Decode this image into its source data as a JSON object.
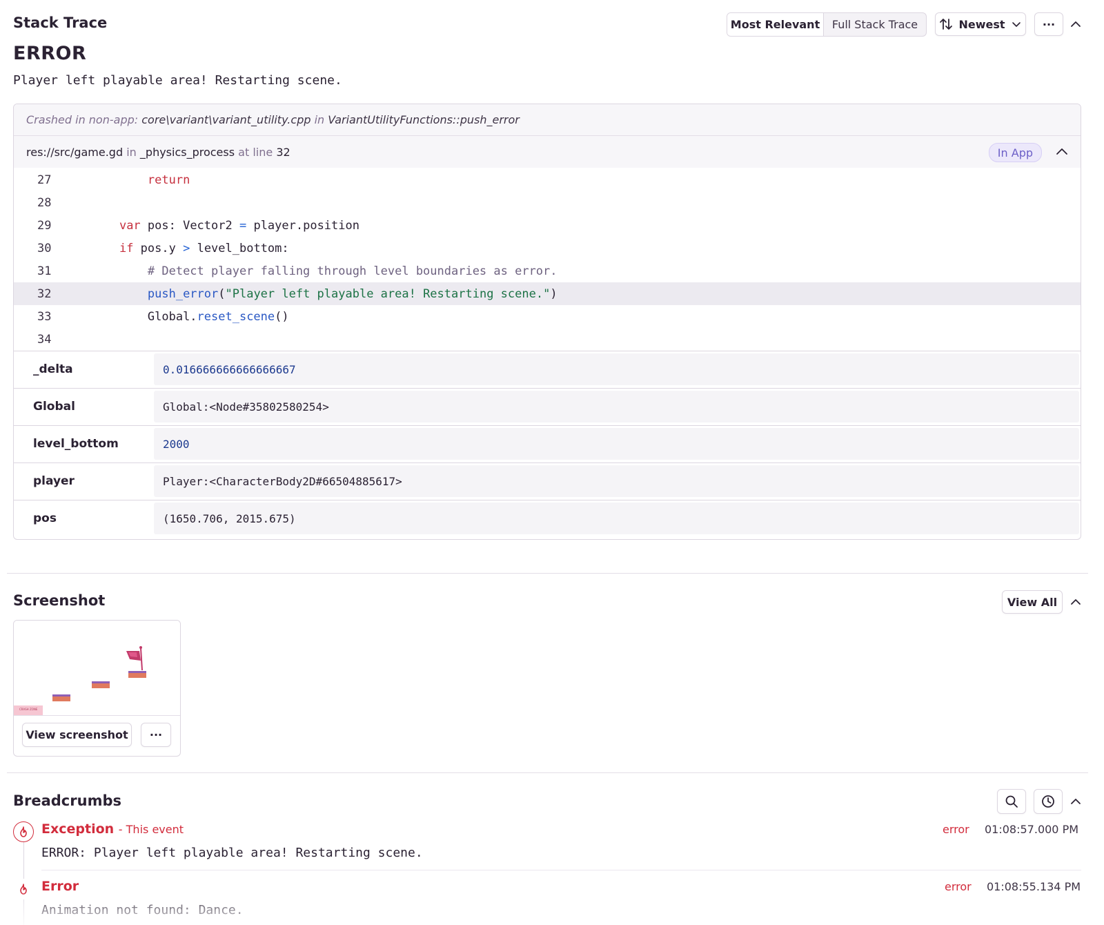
{
  "stack_trace": {
    "title": "Stack Trace",
    "view_options": [
      "Most Relevant",
      "Full Stack Trace"
    ],
    "sort_label": "Newest",
    "more_label": "···",
    "exception_type": "ERROR",
    "exception_message": "Player left playable area! Restarting scene.",
    "crash_prefix": "Crashed in non-app:",
    "crash_file": "core\\variant\\variant_utility.cpp",
    "crash_in": "in",
    "crash_function": "VariantUtilityFunctions::push_error",
    "frame": {
      "file": "res://src/game.gd",
      "in_word": "in",
      "function": "_physics_process",
      "at_line_word": "at line",
      "line": "32",
      "badge": "In App"
    },
    "code_lines": [
      {
        "n": "27",
        "indent": "        ",
        "parts": [
          [
            "kw",
            "return"
          ]
        ]
      },
      {
        "n": "28",
        "indent": "",
        "parts": []
      },
      {
        "n": "29",
        "indent": "    ",
        "parts": [
          [
            "kw",
            "var"
          ],
          [
            "t",
            " pos: Vector2 "
          ],
          [
            "op",
            "="
          ],
          [
            "t",
            " player.position"
          ]
        ]
      },
      {
        "n": "30",
        "indent": "    ",
        "parts": [
          [
            "kw",
            "if"
          ],
          [
            "t",
            " pos.y "
          ],
          [
            "op",
            ">"
          ],
          [
            "t",
            " level_bottom:"
          ]
        ]
      },
      {
        "n": "31",
        "indent": "        ",
        "parts": [
          [
            "cm",
            "# Detect player falling through level boundaries as error."
          ]
        ]
      },
      {
        "n": "32",
        "indent": "        ",
        "parts": [
          [
            "fn",
            "push_error"
          ],
          [
            "t",
            "("
          ],
          [
            "str",
            "\"Player left playable area! Restarting scene.\""
          ],
          [
            "t",
            ")"
          ]
        ],
        "highlight": true
      },
      {
        "n": "33",
        "indent": "        ",
        "parts": [
          [
            "t",
            "Global."
          ],
          [
            "fn",
            "reset_scene"
          ],
          [
            "t",
            "()"
          ]
        ]
      },
      {
        "n": "34",
        "indent": "",
        "parts": []
      }
    ],
    "variables": [
      {
        "key": "_delta",
        "value": "0.016666666666666667",
        "numeric": true
      },
      {
        "key": "Global",
        "value": "Global:<Node#35802580254>",
        "numeric": false
      },
      {
        "key": "level_bottom",
        "value": "2000",
        "numeric": true
      },
      {
        "key": "player",
        "value": "Player:<CharacterBody2D#66504885617>",
        "numeric": false
      },
      {
        "key": "pos",
        "value": "(1650.706, 2015.675)",
        "numeric": false
      }
    ]
  },
  "screenshot": {
    "title": "Screenshot",
    "view_all_label": "View All",
    "view_button_label": "View screenshot",
    "more_label": "···",
    "thumb_badge_text": "CRASH ZONE"
  },
  "breadcrumbs": {
    "title": "Breadcrumbs",
    "items": [
      {
        "type": "Exception",
        "subtitle": "- This event",
        "message": "ERROR: Player left playable area! Restarting scene.",
        "level": "error",
        "time": "01:08:57.000 PM"
      },
      {
        "type": "Error",
        "subtitle": "",
        "message": "Animation not found: Dance.",
        "level": "error",
        "time": "01:08:55.134 PM"
      }
    ]
  },
  "colors": {
    "accent": "#6c5fc7",
    "error": "#d22c3c",
    "text": "#2b2233"
  }
}
